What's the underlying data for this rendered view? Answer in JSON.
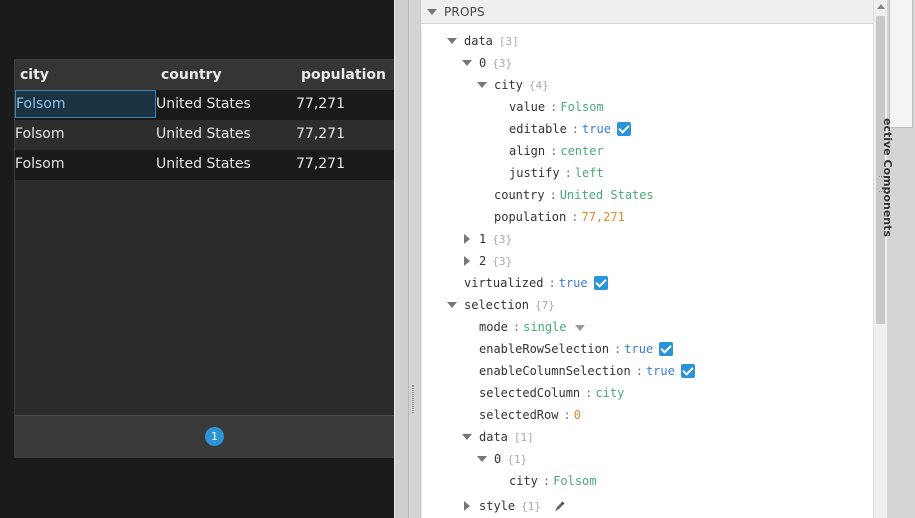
{
  "table": {
    "columns": [
      "city",
      "country",
      "population"
    ],
    "rows": [
      {
        "city": "Folsom",
        "country": "United States",
        "population": "77,271"
      },
      {
        "city": "Folsom",
        "country": "United States",
        "population": "77,271"
      },
      {
        "city": "Folsom",
        "country": "United States",
        "population": "77,271"
      }
    ],
    "selected_cell": {
      "row": 0,
      "column": "city"
    },
    "pager": {
      "current_page": "1"
    }
  },
  "props_panel": {
    "title": "PROPS",
    "tree": {
      "data": {
        "key": "data",
        "count": "[3]"
      },
      "item0": {
        "key": "0",
        "count": "{3}"
      },
      "city": {
        "key": "city",
        "count": "{4}"
      },
      "value": {
        "key": "value",
        "val": "Folsom"
      },
      "editable": {
        "key": "editable",
        "val": "true"
      },
      "align": {
        "key": "align",
        "val": "center"
      },
      "justify": {
        "key": "justify",
        "val": "left"
      },
      "country": {
        "key": "country",
        "val": "United States"
      },
      "population": {
        "key": "population",
        "val": "77,271"
      },
      "item1": {
        "key": "1",
        "count": "{3}"
      },
      "item2": {
        "key": "2",
        "count": "{3}"
      },
      "virtualized": {
        "key": "virtualized",
        "val": "true"
      },
      "selection": {
        "key": "selection",
        "count": "{7}"
      },
      "mode": {
        "key": "mode",
        "val": "single"
      },
      "enableRowSelection": {
        "key": "enableRowSelection",
        "val": "true"
      },
      "enableColumnSelection": {
        "key": "enableColumnSelection",
        "val": "true"
      },
      "selectedColumn": {
        "key": "selectedColumn",
        "val": "city"
      },
      "selectedRow": {
        "key": "selectedRow",
        "val": "0"
      },
      "sel_data": {
        "key": "data",
        "count": "[1]"
      },
      "sel_item0": {
        "key": "0",
        "count": "{1}"
      },
      "sel_city": {
        "key": "city",
        "val": "Folsom"
      },
      "style": {
        "key": "style",
        "count": "{1}"
      }
    }
  },
  "dock": {
    "tab_label": "ective Components"
  },
  "colors": {
    "accent": "#2b94d8",
    "string_value": "#4aa978",
    "boolean_value": "#3b7dd8",
    "number_value": "#e0882f",
    "selected_cell_border": "#3a86b0"
  }
}
